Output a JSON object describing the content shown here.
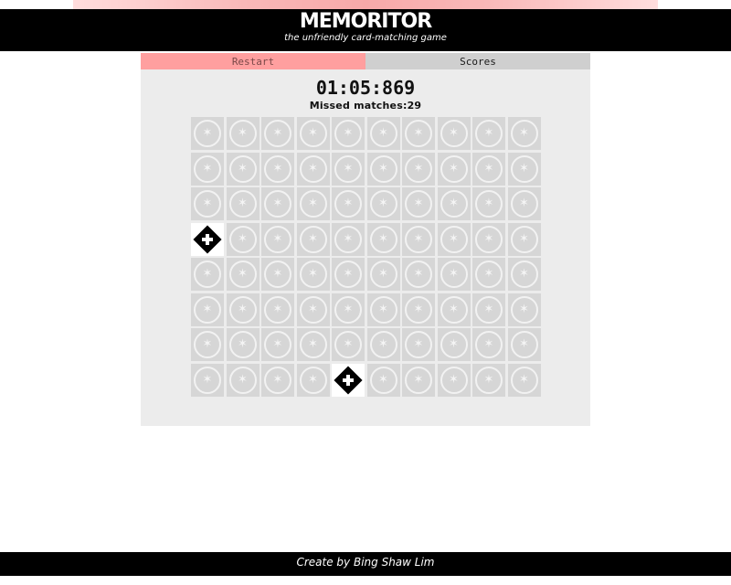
{
  "header": {
    "title": "MEMORITOR",
    "subtitle": "the unfriendly card-matching game"
  },
  "tabs": {
    "restart_label": "Restart",
    "scores_label": "Scores"
  },
  "game": {
    "timer": "01:05:869",
    "missed_label": "Missed matches:",
    "missed_count": "29",
    "rows": 8,
    "cols": 10,
    "revealed_cards": [
      {
        "row": 4,
        "col": 1,
        "symbol": "plus-diamond-icon"
      },
      {
        "row": 8,
        "col": 5,
        "symbol": "plus-diamond-icon"
      }
    ]
  },
  "footer": {
    "credit": "Create by Bing Shaw Lim"
  },
  "colors": {
    "header_bg": "#000000",
    "restart_tab": "#ff9f9f",
    "scores_tab": "#cfcfcf",
    "panel_bg": "#ececec",
    "card_back": "#d6d6d6"
  }
}
